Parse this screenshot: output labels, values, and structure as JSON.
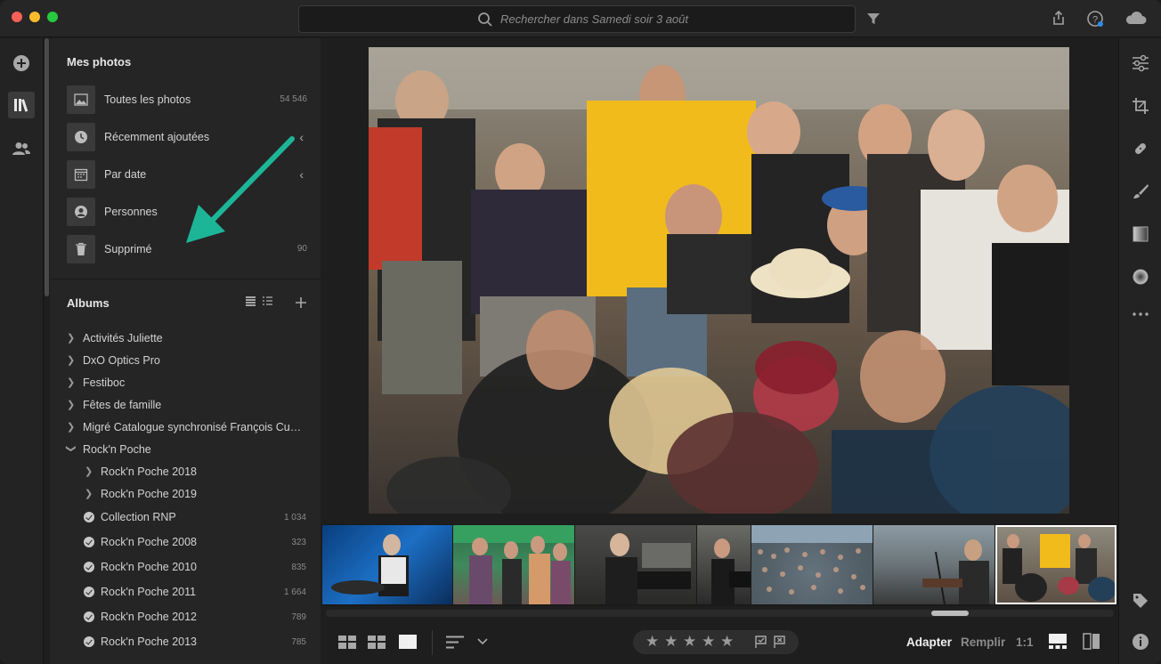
{
  "search": {
    "placeholder": "Rechercher dans Samedi soir 3 août"
  },
  "my_photos": {
    "title": "Mes photos",
    "items": [
      {
        "label": "Toutes les photos",
        "count": "54 546"
      },
      {
        "label": "Récemment ajoutées",
        "count": ""
      },
      {
        "label": "Par date",
        "count": ""
      },
      {
        "label": "Personnes",
        "count": ""
      },
      {
        "label": "Supprimé",
        "count": "90"
      }
    ]
  },
  "albums": {
    "title": "Albums",
    "items": [
      {
        "label": "Activités Juliette"
      },
      {
        "label": "DxO Optics Pro"
      },
      {
        "label": "Festiboc"
      },
      {
        "label": "Fêtes de famille"
      },
      {
        "label": "Migré Catalogue synchronisé François Cuneo..."
      },
      {
        "label": "Rock'n Poche"
      }
    ],
    "sub_folders": [
      {
        "label": "Rock'n Poche 2018"
      },
      {
        "label": "Rock'n Poche 2019"
      }
    ],
    "sub_albums": [
      {
        "label": "Collection RNP",
        "count": "1 034"
      },
      {
        "label": "Rock'n Poche 2008",
        "count": "323"
      },
      {
        "label": "Rock'n Poche 2010",
        "count": "835"
      },
      {
        "label": "Rock'n Poche 2011",
        "count": "1 664"
      },
      {
        "label": "Rock'n Poche 2012",
        "count": "789"
      },
      {
        "label": "Rock'n Poche 2013",
        "count": "785"
      }
    ]
  },
  "bottom": {
    "fit_label": "Adapter",
    "fill_label": "Remplir",
    "ratio_label": "1:1"
  },
  "colors": {
    "accent_arrow": "#1db598",
    "selected_outline": "#ffffff"
  }
}
